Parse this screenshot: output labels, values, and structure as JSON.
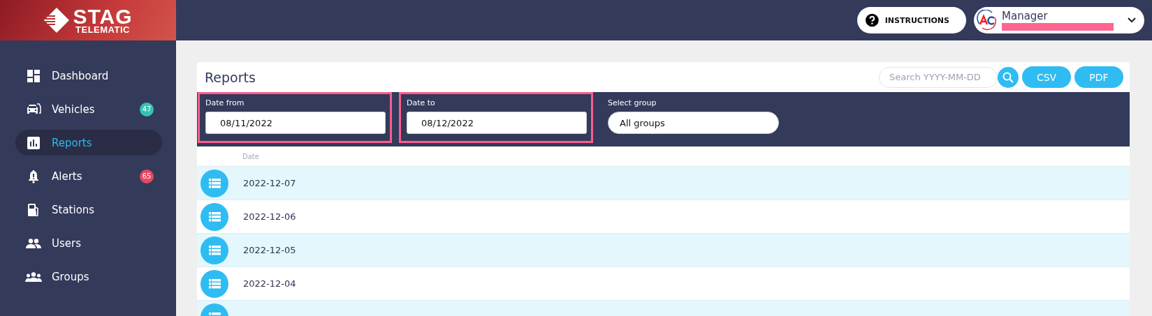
{
  "brand": {
    "name": "STAG",
    "tagline": "TELEMATIC"
  },
  "sidebar": {
    "items": [
      {
        "kind": "dashboard",
        "label": "Dashboard",
        "selected": false
      },
      {
        "kind": "vehicles",
        "label": "Vehicles",
        "selected": false,
        "badge": "47",
        "color": "#35c2b4"
      },
      {
        "kind": "reports",
        "label": "Reports",
        "selected": true
      },
      {
        "kind": "alerts",
        "label": "Alerts",
        "selected": false,
        "badge": "65",
        "color": "#e8475f"
      },
      {
        "kind": "stations",
        "label": "Stations",
        "selected": false
      },
      {
        "kind": "users",
        "label": "Users",
        "selected": false
      },
      {
        "kind": "groups",
        "label": "Groups",
        "selected": false
      }
    ]
  },
  "header": {
    "instructions_button": "INSTRUCTIONS",
    "user": {
      "role": "Manager",
      "name_redacted": true
    }
  },
  "reports": {
    "title": "Reports",
    "search": {
      "placeholder": "Search YYYY-MM-DD"
    },
    "buttons": [
      "CSV",
      "PDF"
    ],
    "filters": [
      {
        "kind": "date",
        "label": "Date from",
        "value": "08/11/2022",
        "highlighted": true
      },
      {
        "kind": "date",
        "label": "Date to",
        "value": "08/12/2022",
        "highlighted": true
      },
      {
        "kind": "select",
        "label": "Select group",
        "value": "All groups"
      }
    ],
    "table": {
      "columns": [
        "Date"
      ],
      "rows": [
        {
          "date": "2022-12-07"
        },
        {
          "date": "2022-12-06"
        },
        {
          "date": "2022-12-05"
        },
        {
          "date": "2022-12-04"
        }
      ]
    }
  }
}
